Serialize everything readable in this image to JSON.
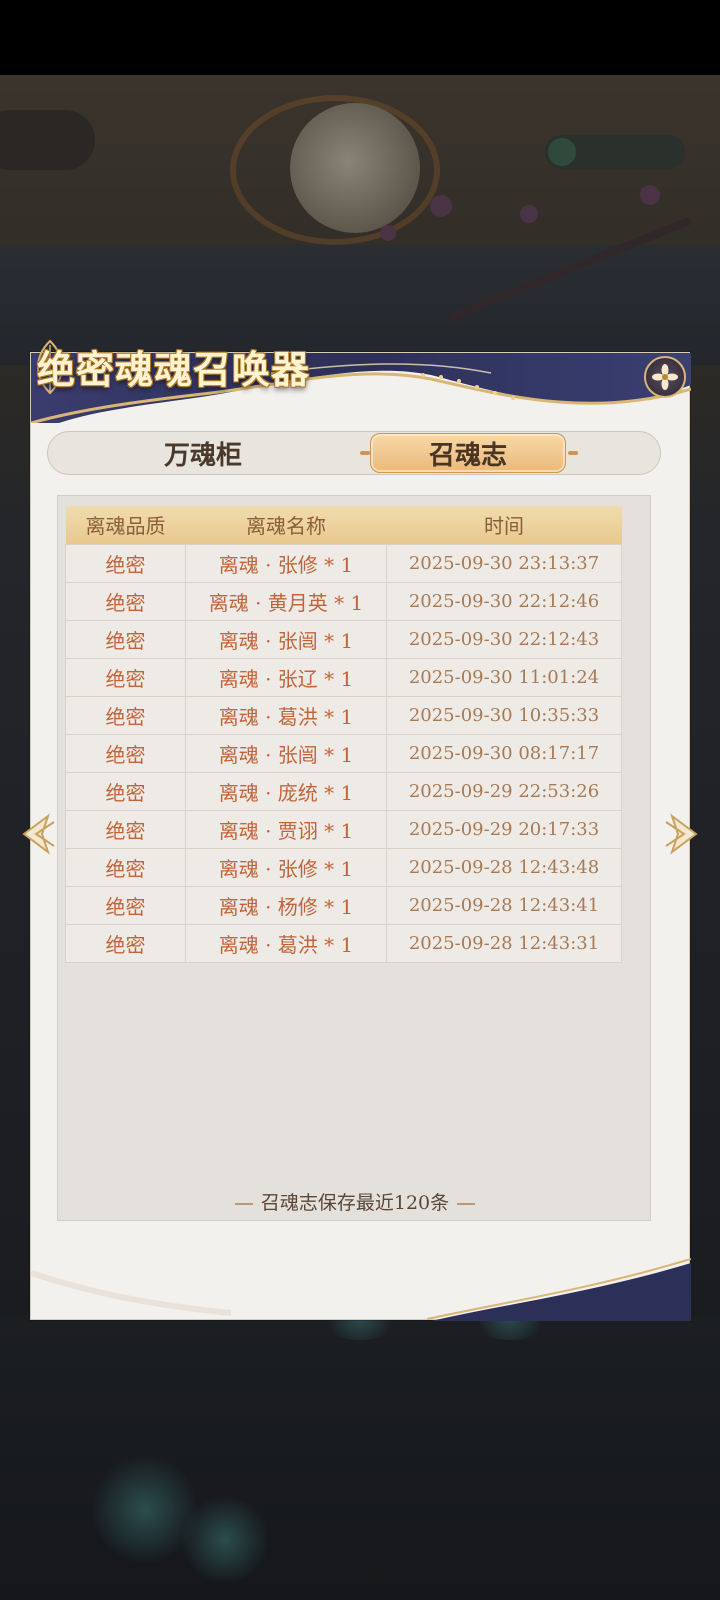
{
  "dialog": {
    "title": "绝密魂魂召唤器",
    "close_icon": "close-flower-icon"
  },
  "tabs": [
    {
      "label": "万魂柜",
      "active": false
    },
    {
      "label": "召魂志",
      "active": true
    }
  ],
  "table": {
    "headers": [
      "离魂品质",
      "离魂名称",
      "时间"
    ],
    "rows": [
      {
        "quality": "绝密",
        "name": "离魂 · 张修 * 1",
        "time": "2025-09-30 23:13:37"
      },
      {
        "quality": "绝密",
        "name": "离魂 · 黄月英 * 1",
        "time": "2025-09-30 22:12:46"
      },
      {
        "quality": "绝密",
        "name": "离魂 · 张闿 * 1",
        "time": "2025-09-30 22:12:43"
      },
      {
        "quality": "绝密",
        "name": "离魂 · 张辽 * 1",
        "time": "2025-09-30 11:01:24"
      },
      {
        "quality": "绝密",
        "name": "离魂 · 葛洪 * 1",
        "time": "2025-09-30 10:35:33"
      },
      {
        "quality": "绝密",
        "name": "离魂 · 张闿 * 1",
        "time": "2025-09-30 08:17:17"
      },
      {
        "quality": "绝密",
        "name": "离魂 · 庞统 * 1",
        "time": "2025-09-29 22:53:26"
      },
      {
        "quality": "绝密",
        "name": "离魂 · 贾诩 * 1",
        "time": "2025-09-29 20:17:33"
      },
      {
        "quality": "绝密",
        "name": "离魂 · 张修 * 1",
        "time": "2025-09-28 12:43:48"
      },
      {
        "quality": "绝密",
        "name": "离魂 · 杨修 * 1",
        "time": "2025-09-28 12:43:41"
      },
      {
        "quality": "绝密",
        "name": "离魂 · 葛洪 * 1",
        "time": "2025-09-28 12:43:31"
      }
    ]
  },
  "footer_note": "召魂志保存最近120条",
  "navigation": {
    "prev_icon": "chevron-left-icon",
    "next_icon": "chevron-right-icon"
  },
  "colors": {
    "header_band": "#2c3058",
    "gold": "#d9b675",
    "tab_active": "#ebb97a",
    "cell_text": "#c2643a",
    "time_text": "#a77a55"
  }
}
